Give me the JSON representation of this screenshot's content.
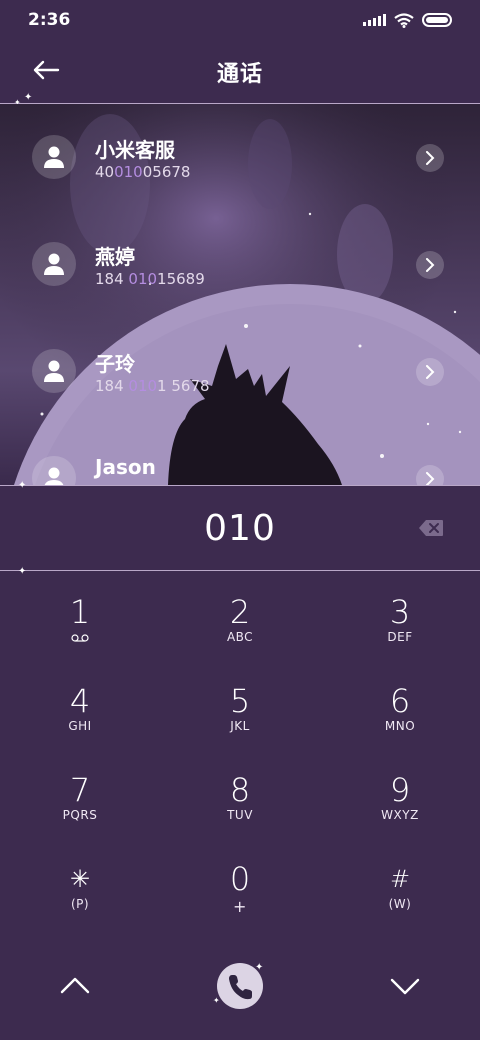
{
  "status_bar": {
    "time": "2:36"
  },
  "header": {
    "title": "通话"
  },
  "contacts": [
    {
      "name": "小米客服",
      "number_parts": [
        "40",
        "010",
        "05678"
      ]
    },
    {
      "name": "燕婷",
      "number_parts": [
        "184 ",
        "010",
        "15689"
      ]
    },
    {
      "name": "子玲",
      "number_parts": [
        "184 ",
        "010",
        "1 5678"
      ]
    },
    {
      "name": "Jason",
      "number_parts": [
        "",
        "",
        ""
      ]
    }
  ],
  "dial_input": {
    "value": "010"
  },
  "keypad": [
    {
      "digit": "1",
      "sub": "voicemail-icon"
    },
    {
      "digit": "2",
      "sub": "ABC"
    },
    {
      "digit": "3",
      "sub": "DEF"
    },
    {
      "digit": "4",
      "sub": "GHI"
    },
    {
      "digit": "5",
      "sub": "JKL"
    },
    {
      "digit": "6",
      "sub": "MNO"
    },
    {
      "digit": "7",
      "sub": "PQRS"
    },
    {
      "digit": "8",
      "sub": "TUV"
    },
    {
      "digit": "9",
      "sub": "WXYZ"
    },
    {
      "digit": "✳",
      "sub": "(P)"
    },
    {
      "digit": "0",
      "sub": "+"
    },
    {
      "digit": "#",
      "sub": "(W)"
    }
  ],
  "colors": {
    "background": "#3d2b4f",
    "highlight": "#b48de0",
    "divider": "#b9a7c8"
  }
}
